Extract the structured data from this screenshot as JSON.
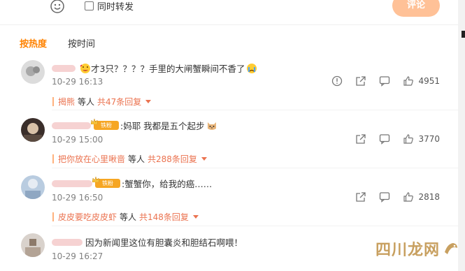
{
  "toolbar": {
    "emoji_icon": "smiley-face-icon",
    "repost_label": "同时转发",
    "comment_button": "评论"
  },
  "tabs": [
    {
      "label": "按热度",
      "active": true
    },
    {
      "label": "按时间",
      "active": false
    }
  ],
  "comments": [
    {
      "text": "才3只？？？？手里的大闸蟹瞬间不香了",
      "time": "10-29 16:13",
      "likes": "4951",
      "has_report": true,
      "reply_user": "揭熊",
      "reply_mid": "等人",
      "reply_count": "共47条回复"
    },
    {
      "badge": "铁粉",
      "text": ":妈耶 我都是五个起步",
      "time": "10-29 15:00",
      "likes": "3770",
      "reply_user": "把你放在心里啾啬",
      "reply_mid": "等人",
      "reply_count": "共288条回复"
    },
    {
      "badge": "铁粉",
      "text": ":蟹蟹你，给我的癌……",
      "time": "10-29 16:50",
      "likes": "2818",
      "reply_user": "皮皮要吃皮皮虾",
      "reply_mid": "等人",
      "reply_count": "共148条回复"
    },
    {
      "text": "因为新闻里这位有胆囊炎和胆结石啊喂！",
      "time": "10-29 16:27"
    }
  ],
  "icons": {
    "report": "exclamation-circle-icon",
    "share": "share-arrow-icon",
    "reply": "comment-bubble-icon",
    "like": "thumbs-up-icon"
  },
  "watermark": {
    "text": "四川龙网"
  },
  "colors": {
    "accent": "#ff8200",
    "reply_link": "#eb7350",
    "comment_button": "#ffc197",
    "badge": "#f6a623"
  }
}
